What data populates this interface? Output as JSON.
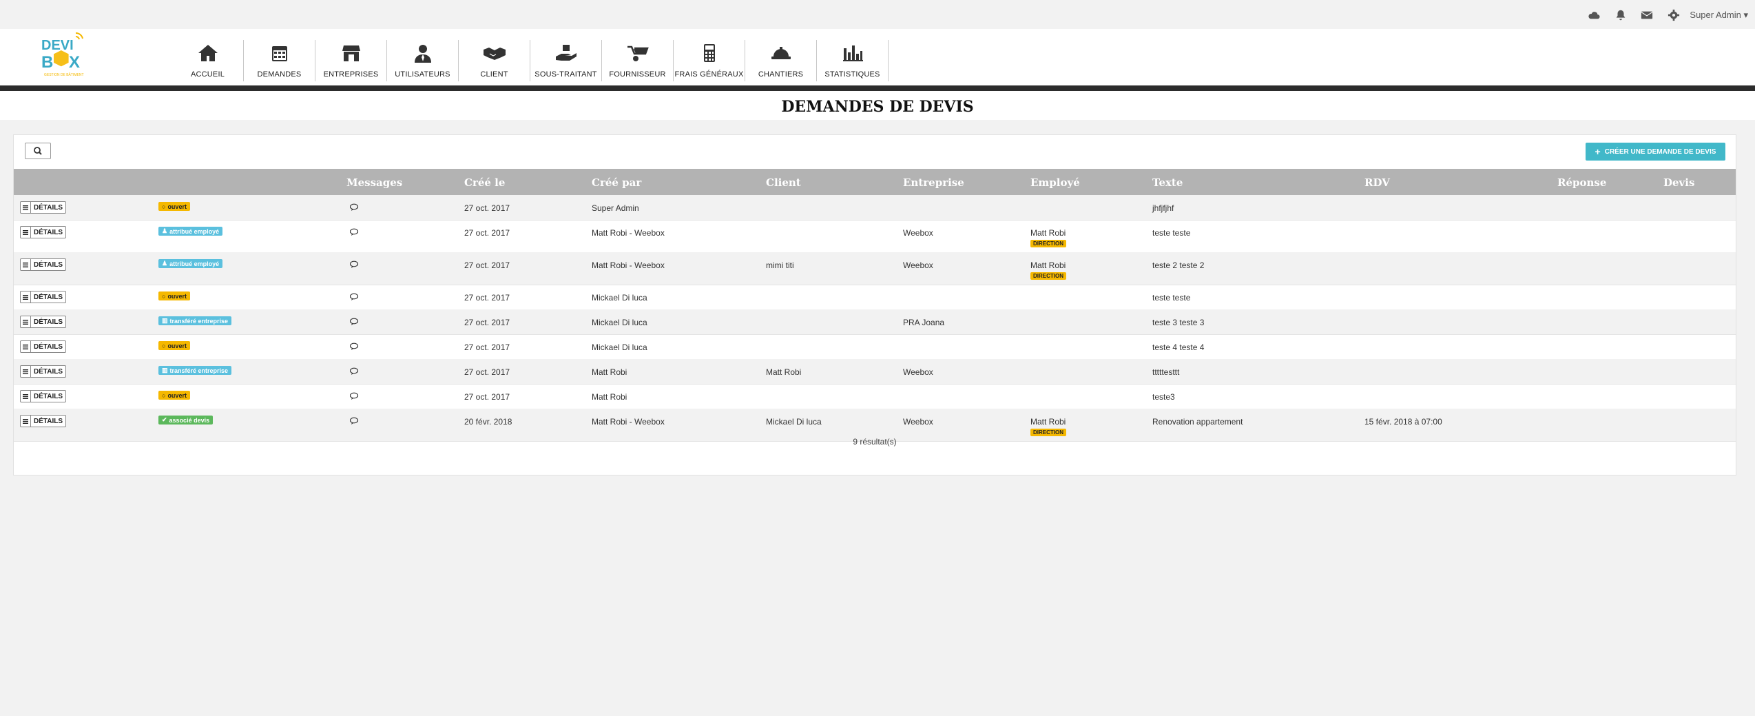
{
  "topbar": {
    "icons": [
      "cloud-icon",
      "bell-icon",
      "envelope-icon",
      "gear-icon"
    ],
    "user_label": "Super Admin",
    "caret": "▾"
  },
  "logo": {
    "text": "DEVI BOX",
    "tagline": "GESTION DE BÂTIMENT"
  },
  "nav": [
    {
      "label": "ACCUEIL",
      "icon": "home-icon"
    },
    {
      "label": "DEMANDES",
      "icon": "calendar-icon"
    },
    {
      "label": "ENTREPRISES",
      "icon": "store-icon"
    },
    {
      "label": "UTILISATEURS",
      "icon": "user-tie-icon"
    },
    {
      "label": "CLIENT",
      "icon": "handshake-icon"
    },
    {
      "label": "SOUS-TRAITANT",
      "icon": "hand-holding-icon"
    },
    {
      "label": "FOURNISSEUR",
      "icon": "wheelbarrow-icon"
    },
    {
      "label": "FRAIS GÉNÉRAUX",
      "icon": "calculator-icon"
    },
    {
      "label": "CHANTIERS",
      "icon": "hard-hat-icon"
    },
    {
      "label": "STATISTIQUES",
      "icon": "bar-chart-icon"
    }
  ],
  "page": {
    "title": "DEMANDES DE DEVIS"
  },
  "toolbar": {
    "create_label": "CRÉER UNE DEMANDE DE DEVIS",
    "create_plus": "+"
  },
  "columns": [
    "Messages",
    "Créé le",
    "Créé par",
    "Client",
    "Entreprise",
    "Employé",
    "Texte",
    "RDV",
    "Réponse",
    "Devis"
  ],
  "details_label": "DÉTAILS",
  "rows": [
    {
      "status": "ouvert",
      "status_type": "ouvert",
      "status_glyph": "○",
      "date": "27 oct. 2017",
      "created_by": "Super Admin",
      "client": "",
      "entreprise": "",
      "employe": "",
      "role": "",
      "texte": "jhfjfjhf",
      "rdv": ""
    },
    {
      "status": "attribué employé",
      "status_type": "employe",
      "status_glyph": "♟",
      "date": "27 oct. 2017",
      "created_by": "Matt Robi - Weebox",
      "client": "",
      "entreprise": "Weebox",
      "employe": "Matt Robi",
      "role": "DIRECTION",
      "texte": "teste teste",
      "rdv": ""
    },
    {
      "status": "attribué employé",
      "status_type": "employe",
      "status_glyph": "♟",
      "date": "27 oct. 2017",
      "created_by": "Matt Robi - Weebox",
      "client": "mimi titi",
      "entreprise": "Weebox",
      "employe": "Matt Robi",
      "role": "DIRECTION",
      "texte": "teste 2 teste 2",
      "rdv": ""
    },
    {
      "status": "ouvert",
      "status_type": "ouvert",
      "status_glyph": "○",
      "date": "27 oct. 2017",
      "created_by": "Mickael Di luca",
      "client": "",
      "entreprise": "",
      "employe": "",
      "role": "",
      "texte": "teste teste",
      "rdv": ""
    },
    {
      "status": "transféré entreprise",
      "status_type": "transfere",
      "status_glyph": "▥",
      "date": "27 oct. 2017",
      "created_by": "Mickael Di luca",
      "client": "",
      "entreprise": "PRA Joana",
      "employe": "",
      "role": "",
      "texte": "teste 3 teste 3",
      "rdv": ""
    },
    {
      "status": "ouvert",
      "status_type": "ouvert",
      "status_glyph": "○",
      "date": "27 oct. 2017",
      "created_by": "Mickael Di luca",
      "client": "",
      "entreprise": "",
      "employe": "",
      "role": "",
      "texte": "teste 4 teste 4",
      "rdv": ""
    },
    {
      "status": "transféré entreprise",
      "status_type": "transfere",
      "status_glyph": "▥",
      "date": "27 oct. 2017",
      "created_by": "Matt Robi",
      "client": "Matt Robi",
      "entreprise": "Weebox",
      "employe": "",
      "role": "",
      "texte": "tttttesttt",
      "rdv": ""
    },
    {
      "status": "ouvert",
      "status_type": "ouvert",
      "status_glyph": "○",
      "date": "27 oct. 2017",
      "created_by": "Matt Robi",
      "client": "",
      "entreprise": "",
      "employe": "",
      "role": "",
      "texte": "teste3",
      "rdv": ""
    },
    {
      "status": "associé devis",
      "status_type": "devis",
      "status_glyph": "✔",
      "date": "20 févr. 2018",
      "created_by": "Matt Robi - Weebox",
      "client": "Mickael Di luca",
      "entreprise": "Weebox",
      "employe": "Matt Robi",
      "role": "DIRECTION",
      "texte": "Renovation appartement",
      "rdv": "15 févr. 2018 à 07:00"
    }
  ],
  "footer": {
    "results": "9 résultat(s)"
  },
  "colors": {
    "accent": "#41b8c9",
    "warning": "#f5b800",
    "info": "#5bc0de",
    "success": "#5cb85c",
    "header": "#b3b3b3"
  }
}
